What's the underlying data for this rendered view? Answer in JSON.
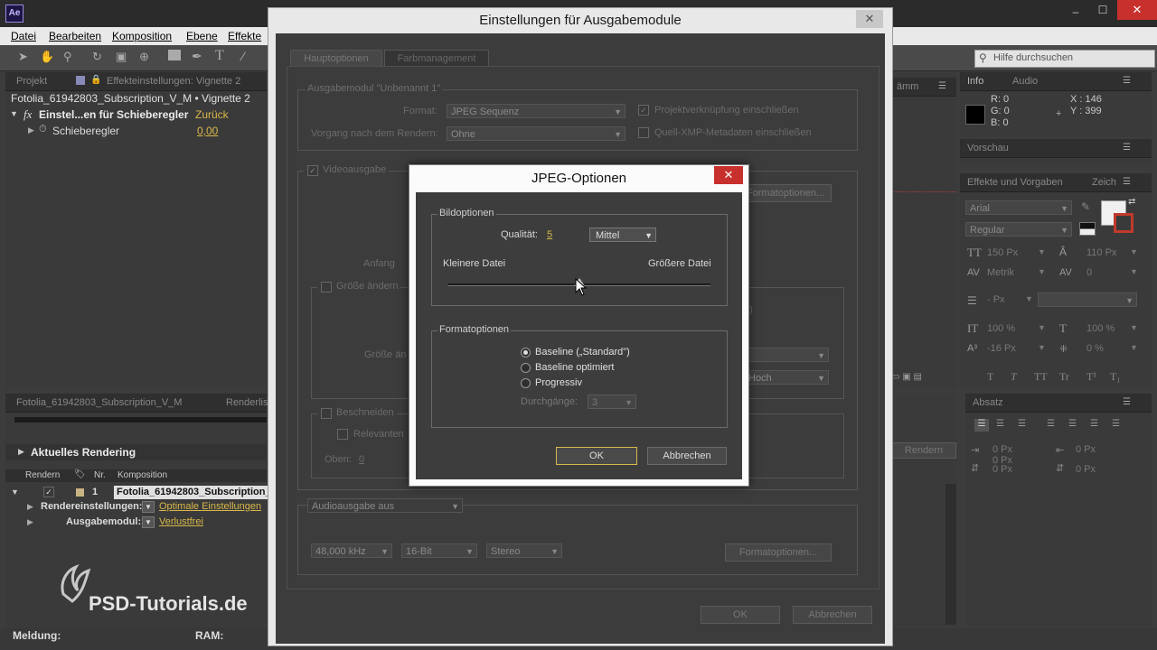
{
  "app": {
    "icon_text": "Ae",
    "window_controls": [
      "–",
      "☐",
      "✕"
    ]
  },
  "menu": [
    "Datei",
    "Bearbeiten",
    "Komposition",
    "Ebene",
    "Effekte"
  ],
  "search": {
    "placeholder": "Hilfe durchsuchen"
  },
  "left_panel": {
    "tabs": [
      "Projekt",
      "Effekteinstellungen: Vignette 2"
    ],
    "subtitle": "Fotolia_61942803_Subscription_V_M • Vignette 2",
    "effect": {
      "name": "Einstel...en für Schieberegler",
      "reset": "Zurück"
    },
    "param": {
      "name": "Schieberegler",
      "value": "0,00"
    }
  },
  "render_panel": {
    "tabs": [
      "Fotolia_61942803_Subscription_V_M",
      "Renderlis"
    ],
    "current": "Aktuelles Rendering",
    "headers": [
      "Rendern",
      "Nr.",
      "Komposition"
    ],
    "row": {
      "num": "1",
      "comp": "Fotolia_61942803_Subscription_V"
    },
    "settings": [
      {
        "label": "Rendereinstellungen:",
        "value": "Optimale Einstellungen"
      },
      {
        "label": "Ausgabemodul:",
        "value": "Verlustfrei"
      }
    ],
    "watermark": "PSD-Tutorials.de",
    "status": {
      "left": "Meldung:",
      "ram": "RAM:"
    }
  },
  "right_panel": {
    "info_tabs": [
      "Info",
      "Audio"
    ],
    "info": {
      "r": "R:  0",
      "g": "G:  0",
      "b": "B:  0",
      "a": "A:  226",
      "x": "X : 146",
      "y": "Y : 399"
    },
    "preview_tab": "Vorschau",
    "effects_tab": "Effekte und Vorgaben",
    "char_tab": "Zeich",
    "font": "Arial",
    "style": "Regular",
    "size": "150 Px",
    "leading": "110 Px",
    "kerning": "Metrik",
    "tracking": "0",
    "indent": "- Px",
    "vscale": "100 %",
    "hscale": "100 %",
    "baseline": "-16 Px",
    "tsume": "0 %",
    "text_buttons": [
      "T",
      "T",
      "TT",
      "Tr",
      "T¹",
      "T₁"
    ],
    "para_tab": "Absatz",
    "para_values": [
      "0 Px",
      "0 Px",
      "0 Px",
      "0 Px",
      "0 Px"
    ],
    "comp_tab": "ämm",
    "render_btn": "Rendern"
  },
  "big_dialog": {
    "title": "Einstellungen für Ausgabemodule",
    "tabs": [
      "Hauptoptionen",
      "Farbmanagement"
    ],
    "module_group": "Ausgabemodul \"Unbenannt 1\"",
    "format_label": "Format:",
    "format_value": "JPEG Sequenz",
    "post_label": "Vorgang nach dem Rendern:",
    "post_value": "Ohne",
    "check1": "Projektverknüpfung einschließen",
    "check2": "Quell-XMP-Metadaten einschließen",
    "video_output": "Videoausgabe",
    "format_options_btn": "Formatoptionen...",
    "start_label": "Anfang",
    "resize_label": "Größe ändern",
    "resize_to": "Größe än",
    "ratio_fragment": "3)",
    "quality_fragment": "Hoch",
    "crop_label": "Beschneiden",
    "relevant_label": "Relevanten",
    "top_label": "Oben:",
    "top_value": "0",
    "audio_output": "Audioausgabe aus",
    "audio_rate": "48,000 kHz",
    "audio_bits": "16-Bit",
    "audio_channels": "Stereo",
    "audio_format_btn": "Formatoptionen...",
    "ok": "OK",
    "cancel": "Abbrechen",
    "close": "✕"
  },
  "jpeg_dialog": {
    "title": "JPEG-Optionen",
    "close": "✕",
    "image_group": "Bildoptionen",
    "quality_label": "Qualität:",
    "quality_value": "5",
    "quality_select": "Mittel",
    "smaller": "Kleinere Datei",
    "larger": "Größere Datei",
    "slider_fraction": 0.5,
    "format_group": "Formatoptionen",
    "options": [
      "Baseline („Standard\")",
      "Baseline optimiert",
      "Progressiv"
    ],
    "selected_option": 0,
    "passes_label": "Durchgänge:",
    "passes_value": "3",
    "ok": "OK",
    "cancel": "Abbrechen"
  }
}
